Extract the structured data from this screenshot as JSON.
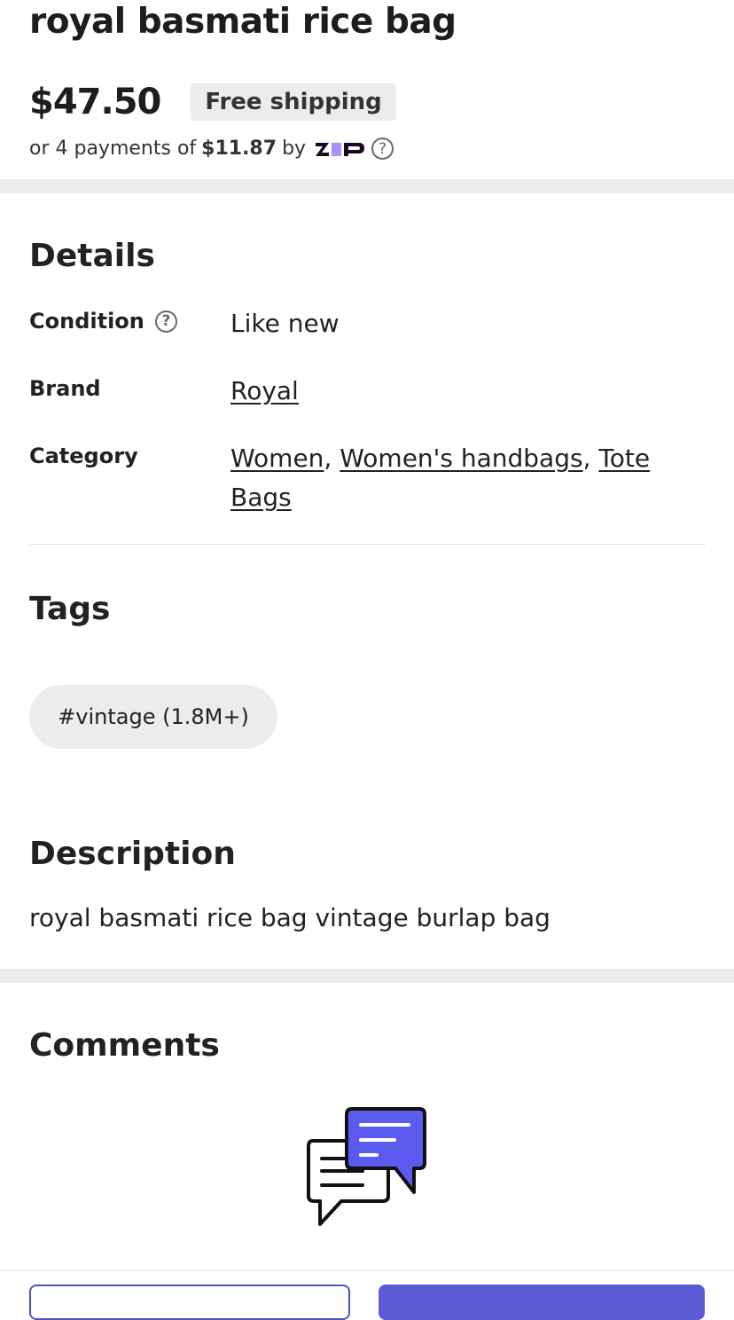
{
  "listing": {
    "title": "royal basmati rice bag",
    "price": "$47.50",
    "shipping_badge": "Free shipping",
    "payment": {
      "prefix": "or 4 payments of",
      "amount": "$11.87",
      "by": "by",
      "provider": "zip",
      "help_icon": "question-circle-icon"
    }
  },
  "details": {
    "heading": "Details",
    "condition_label": "Condition",
    "condition_value": "Like new",
    "brand_label": "Brand",
    "brand_value": "Royal",
    "category_label": "Category",
    "categories": [
      "Women",
      "Women's handbags",
      "Tote Bags"
    ],
    "separator": ","
  },
  "tags": {
    "heading": "Tags",
    "items": [
      "#vintage (1.8M+)"
    ]
  },
  "description": {
    "heading": "Description",
    "text": "royal basmati rice bag vintage burlap bag"
  },
  "comments": {
    "heading": "Comments",
    "icon": "chat-bubbles-icon"
  },
  "colors": {
    "accent": "#5b5bd6",
    "band": "#ececef",
    "text": "#222222"
  }
}
